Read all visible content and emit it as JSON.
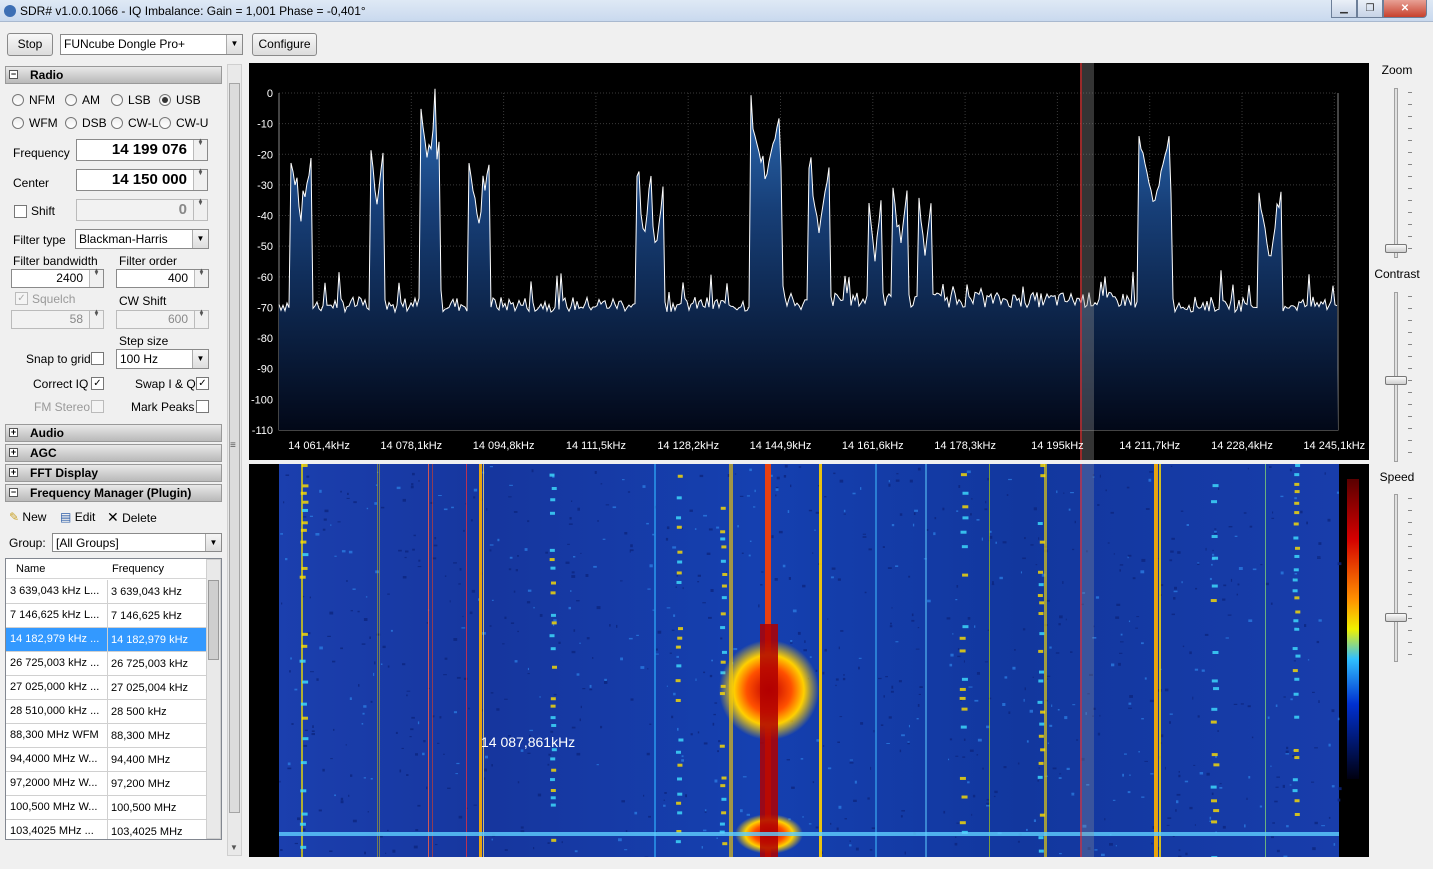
{
  "window": {
    "title": "SDR# v1.0.0.1066 - IQ Imbalance: Gain = 1,001 Phase = -0,401°"
  },
  "toolbar": {
    "stop_label": "Stop",
    "device": "FUNcube Dongle Pro+",
    "configure_label": "Configure"
  },
  "radio": {
    "section_title": "Radio",
    "modes_row1": [
      "NFM",
      "AM",
      "LSB",
      "USB"
    ],
    "modes_row2": [
      "WFM",
      "DSB",
      "CW-L",
      "CW-U"
    ],
    "selected_mode": "USB",
    "frequency_label": "Frequency",
    "frequency_value": "14 199 076",
    "center_label": "Center",
    "center_value": "14 150 000",
    "shift_label": "Shift",
    "shift_value": "0",
    "filter_type_label": "Filter type",
    "filter_type_value": "Blackman-Harris",
    "filter_bandwidth_label": "Filter bandwidth",
    "filter_bandwidth_value": "2400",
    "filter_order_label": "Filter order",
    "filter_order_value": "400",
    "squelch_label": "Squelch",
    "squelch_value": "58",
    "cw_shift_label": "CW Shift",
    "cw_shift_value": "600",
    "step_size_label": "Step size",
    "step_size_value": "100 Hz",
    "snap_to_grid_label": "Snap to grid",
    "correct_iq_label": "Correct IQ",
    "swap_iq_label": "Swap I & Q",
    "fm_stereo_label": "FM Stereo",
    "mark_peaks_label": "Mark Peaks"
  },
  "sections": {
    "audio": "Audio",
    "agc": "AGC",
    "fft_display": "FFT Display",
    "freq_manager": "Frequency Manager (Plugin)"
  },
  "freq_manager": {
    "new_label": "New",
    "edit_label": "Edit",
    "delete_label": "Delete",
    "group_label": "Group:",
    "group_value": "[All Groups]",
    "col_name": "Name",
    "col_frequency": "Frequency",
    "rows": [
      {
        "name": "3 639,043 kHz L...",
        "freq": "3 639,043 kHz"
      },
      {
        "name": "7 146,625 kHz L...",
        "freq": "7 146,625 kHz"
      },
      {
        "name": "14 182,979 kHz ...",
        "freq": "14 182,979 kHz"
      },
      {
        "name": "26 725,003 kHz ...",
        "freq": "26 725,003 kHz"
      },
      {
        "name": "27 025,000 kHz ...",
        "freq": "27 025,004 kHz"
      },
      {
        "name": "28 510,000 kHz ...",
        "freq": "28 500 kHz"
      },
      {
        "name": "88,300 MHz WFM",
        "freq": "88,300 MHz"
      },
      {
        "name": "94,4000 MHz W...",
        "freq": "94,400 MHz"
      },
      {
        "name": "97,2000 MHz W...",
        "freq": "97,200 MHz"
      },
      {
        "name": "100,500 MHz W...",
        "freq": "100,500 MHz"
      },
      {
        "name": "103,4025 MHz ...",
        "freq": "103,4025 MHz"
      }
    ]
  },
  "spectrum": {
    "y_ticks": [
      "0",
      "-10",
      "-20",
      "-30",
      "-40",
      "-50",
      "-60",
      "-70",
      "-80",
      "-90",
      "-100",
      "-110"
    ],
    "x_ticks": [
      "14 061,4kHz",
      "14 078,1kHz",
      "14 094,8kHz",
      "14 111,5kHz",
      "14 128,2kHz",
      "14 144,9kHz",
      "14 161,6kHz",
      "14 178,3kHz",
      "14 195kHz",
      "14 211,7kHz",
      "14 228,4kHz",
      "14 245,1kHz"
    ]
  },
  "waterfall": {
    "cursor_label": "14 087,861kHz"
  },
  "sliders": {
    "zoom_label": "Zoom",
    "contrast_label": "Contrast",
    "speed_label": "Speed"
  }
}
